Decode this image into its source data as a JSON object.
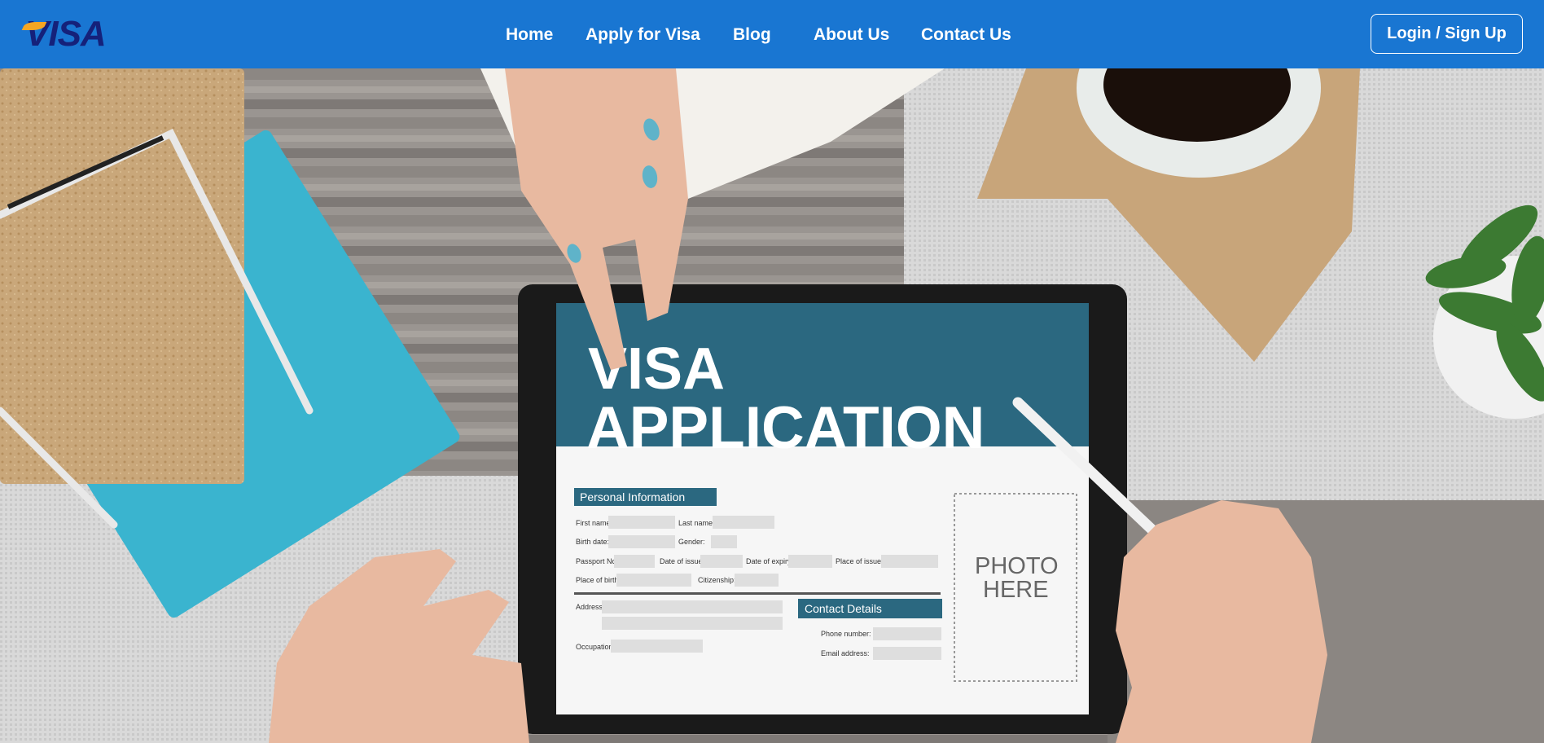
{
  "brand": {
    "logo_text": "VISA",
    "color": "#15217a",
    "accent": "#f5a623"
  },
  "navbar": {
    "background": "#1976d2",
    "links": [
      {
        "label": "Home"
      },
      {
        "label": "Apply for Visa"
      },
      {
        "label": "Blog"
      },
      {
        "label": "About Us"
      },
      {
        "label": "Contact Us"
      }
    ],
    "login_label": "Login / Sign Up"
  },
  "hero": {
    "tablet": {
      "title_line1": "VISA",
      "title_line2": "APPLICATION",
      "section_personal": "Personal Information",
      "section_contact": "Contact Details",
      "fields": {
        "first_name": "First name:",
        "last_name": "Last name:",
        "birth_date": "Birth date:",
        "gender": "Gender:",
        "passport_no": "Passport No:",
        "date_of_issue": "Date of issue:",
        "date_of_expiry": "Date of expiry:",
        "place_of_issue": "Place of issue:",
        "place_of_birth": "Place of birth:",
        "citizenship": "Citizenship:",
        "address": "Address:",
        "occupation": "Occupation:",
        "phone_number": "Phone number:",
        "email_address": "Email address:"
      },
      "photo_line1": "PHOTO",
      "photo_line2": "HERE"
    }
  }
}
